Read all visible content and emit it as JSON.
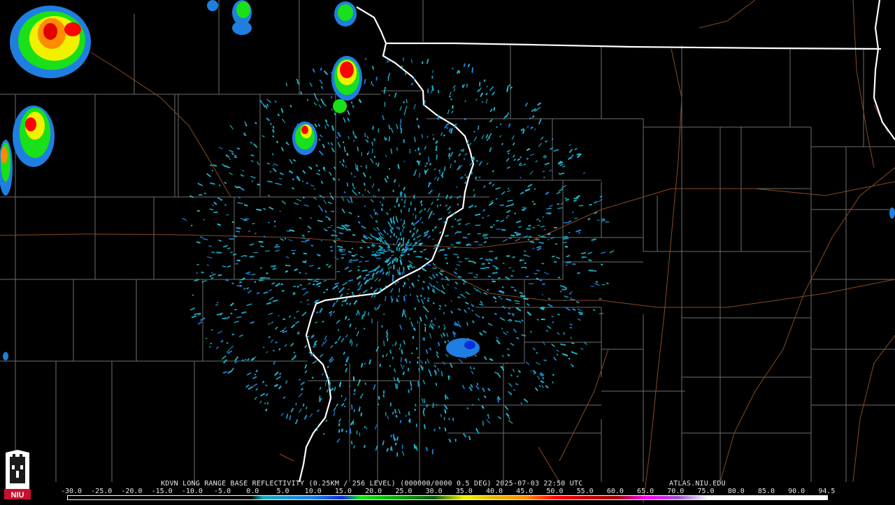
{
  "product": {
    "title": "KDVN LONG RANGE BASE REFLECTIVITY (0.25KM / 256 LEVEL) (000000/0000 0.5 DEG) 2025-07-03 22:50 UTC",
    "site": "ATLAS.NIU.EDU"
  },
  "logo": {
    "text": "NIU",
    "color": "#c8102e"
  },
  "colors": {
    "background": "#000000",
    "county_lines": "#6e6e6e",
    "state_lines": "#ffffff",
    "roads": "#8a4a24"
  },
  "color_scale": {
    "labels": [
      "-30.0",
      "-25.0",
      "-20.0",
      "-15.0",
      "-10.0",
      "-5.0",
      "0.0",
      "5.0",
      "10.0",
      "15.0",
      "20.0",
      "25.0",
      "30.0",
      "35.0",
      "40.0",
      "45.0",
      "50.0",
      "55.0",
      "60.0",
      "65.0",
      "70.0",
      "75.0",
      "80.0",
      "85.0",
      "90.0",
      "94.5"
    ],
    "stops": [
      {
        "dbz": -30,
        "color": "#000000"
      },
      {
        "dbz": 0,
        "color": "#000000"
      },
      {
        "dbz": 2,
        "color": "#1aa9b8"
      },
      {
        "dbz": 10,
        "color": "#1f7fe0"
      },
      {
        "dbz": 15,
        "color": "#0b2fd8"
      },
      {
        "dbz": 18,
        "color": "#19e019"
      },
      {
        "dbz": 25,
        "color": "#0a9a0a"
      },
      {
        "dbz": 30,
        "color": "#0c5e0c"
      },
      {
        "dbz": 35,
        "color": "#f0f000"
      },
      {
        "dbz": 40,
        "color": "#e0b400"
      },
      {
        "dbz": 45,
        "color": "#ff8c00"
      },
      {
        "dbz": 50,
        "color": "#ff0000"
      },
      {
        "dbz": 55,
        "color": "#c80000"
      },
      {
        "dbz": 60,
        "color": "#a00000"
      },
      {
        "dbz": 65,
        "color": "#ff00ff"
      },
      {
        "dbz": 70,
        "color": "#9a55c9"
      },
      {
        "dbz": 75,
        "color": "#ffffff"
      },
      {
        "dbz": 94.5,
        "color": "#ffffff"
      }
    ]
  }
}
